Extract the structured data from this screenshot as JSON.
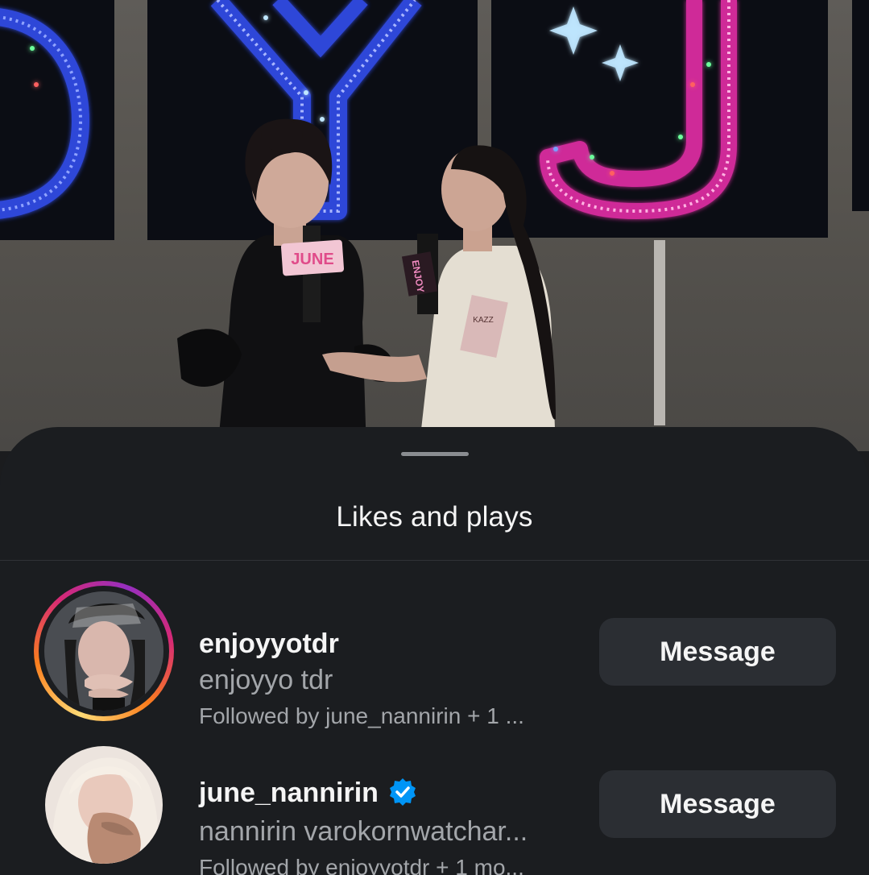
{
  "background": {
    "panel_letters": [
      "Y",
      "J"
    ],
    "mic_flag_text": "JUNE",
    "mic_cube_text": "ENJOY",
    "card_text": "KAZZ"
  },
  "sheet": {
    "title": "Likes and plays"
  },
  "users": [
    {
      "username": "enjoyyotdr",
      "full_name": "enjoyyo tdr",
      "followed_by": "Followed by june_nannirin + 1 ...",
      "verified": false,
      "has_story_ring": true,
      "button_label": "Message"
    },
    {
      "username": "june_nannirin",
      "full_name": "nannirin varokornwatchar...",
      "followed_by": "Followed by enjoyyotdr + 1 mo...",
      "verified": true,
      "has_story_ring": false,
      "button_label": "Message"
    }
  ],
  "colors": {
    "sheet_bg": "#1b1d20",
    "button_bg": "#2b2e33",
    "verified_blue": "#0095f6",
    "neon_blue": "#3a55ff",
    "neon_pink": "#e0309a"
  }
}
